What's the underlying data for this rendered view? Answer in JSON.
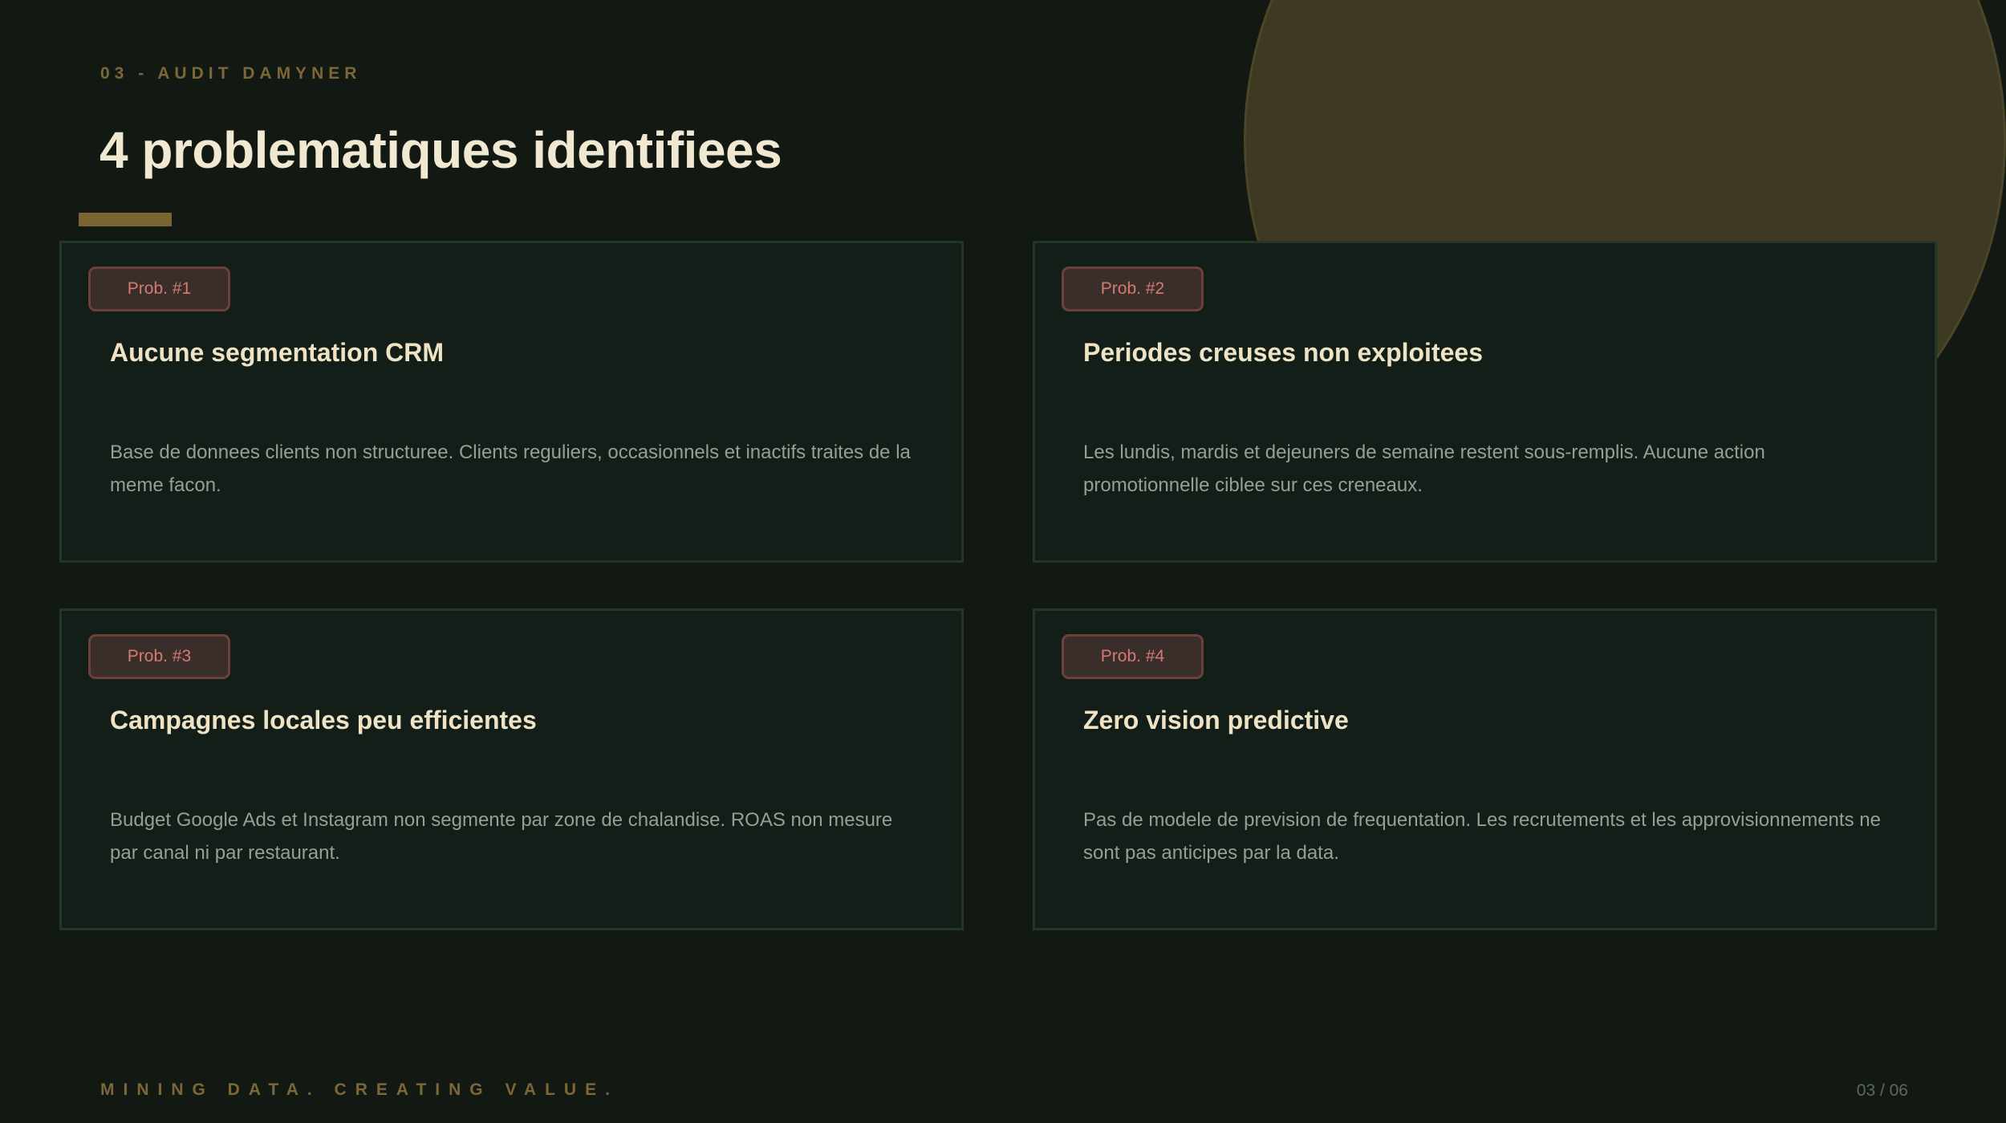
{
  "header": {
    "kicker": "03 - AUDIT DAMYNER",
    "title": "4 problematiques identifiees"
  },
  "problems": [
    {
      "badge": "Prob. #1",
      "title": "Aucune segmentation CRM",
      "description": "Base de donnees clients non structuree. Clients reguliers, occasionnels et inactifs traites de la meme facon."
    },
    {
      "badge": "Prob. #2",
      "title": "Periodes creuses non exploitees",
      "description": "Les lundis, mardis et dejeuners de semaine restent sous-remplis. Aucune action promotionnelle ciblee sur ces creneaux."
    },
    {
      "badge": "Prob. #3",
      "title": "Campagnes locales peu efficientes",
      "description": "Budget Google Ads et Instagram non segmente par zone de chalandise. ROAS non mesure par canal ni par restaurant."
    },
    {
      "badge": "Prob. #4",
      "title": "Zero vision predictive",
      "description": "Pas de modele de prevision de frequentation. Les recrutements et les approvisionnements ne sont pas anticipes par la data."
    }
  ],
  "footer": {
    "tagline": "MINING DATA. CREATING VALUE.",
    "page_counter": "03 / 06"
  },
  "colors": {
    "background": "#111912",
    "accent_gold": "#7b6433",
    "circle": "#3d3923",
    "card_bg": "#131e18",
    "card_border": "#233629",
    "badge_text": "#d57a73",
    "title_text": "#f1e8d2",
    "body_text": "#93a096"
  }
}
